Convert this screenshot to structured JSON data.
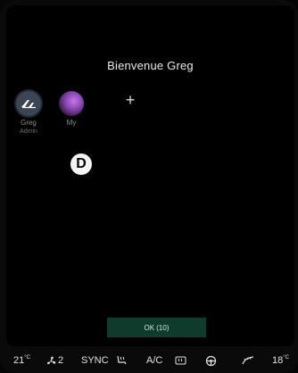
{
  "header": {
    "welcome": "Bienvenue Greg"
  },
  "profiles": [
    {
      "name": "Greg",
      "role": "Admin",
      "icon": "alpine-logo-icon"
    },
    {
      "name": "My",
      "role": "",
      "icon": "purple-avatar-icon"
    }
  ],
  "add_profile": {
    "label": "+",
    "icon": "plus-icon"
  },
  "marker": {
    "label": "D"
  },
  "footer_button": {
    "label": "OK (10)"
  },
  "climate_bar": {
    "temp_left": "21",
    "temp_right": "18",
    "unit": "°C",
    "fan_level": "2",
    "sync_label": "SYNC",
    "ac_label": "A/C",
    "icons": [
      "fan-icon",
      "heated-seat-icon",
      "rear-defrost-icon",
      "heated-wheel-icon",
      "windshield-air-icon"
    ]
  },
  "colors": {
    "ok_button": "#0f3b2c",
    "profile_accent": "#7e3ea8"
  }
}
